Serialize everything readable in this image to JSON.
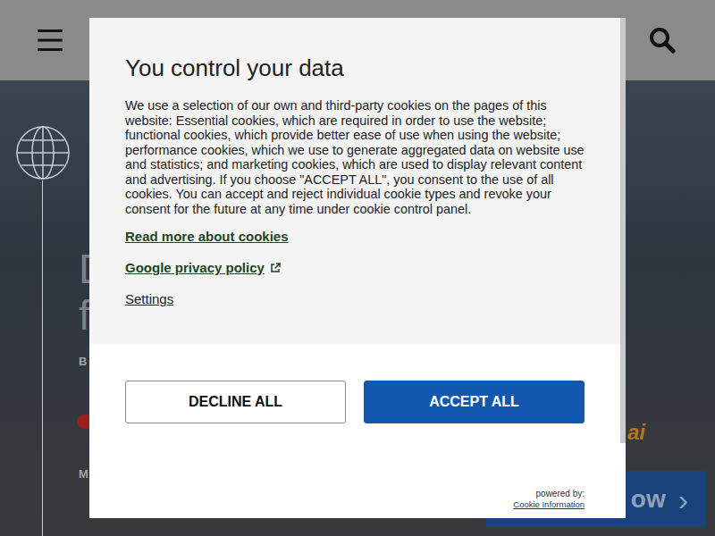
{
  "hero": {
    "fragments": [
      {
        "text": "D",
        "kind": "heading"
      },
      {
        "text": "f",
        "kind": "heading"
      },
      {
        "text": "B",
        "kind": "small"
      },
      {
        "text": "M",
        "kind": "label"
      }
    ],
    "accent": "ai",
    "cta": {
      "label": "ow",
      "icon": "›"
    }
  },
  "dialog": {
    "title": "You control your data",
    "body": "We use a selection of our own and third-party cookies on the pages of this website: Essential cookies, which are required in order to use the website; functional cookies, which provide better ease of use when using the website; performance cookies, which we use to generate aggregated data on website use and statistics; and marketing cookies, which are used to display relevant content and advertising. If you choose \"ACCEPT ALL\", you consent to the use of all cookies. You can accept and reject individual cookie types and revoke your consent for the future at any time under cookie control panel.",
    "links": [
      {
        "label": "Read more about cookies",
        "external": false
      },
      {
        "label": "Google privacy policy",
        "external": true
      }
    ],
    "settings": "Settings",
    "buttons": [
      {
        "label": "DECLINE ALL",
        "kind": "secondary"
      },
      {
        "label": "ACCEPT ALL",
        "kind": "primary"
      }
    ],
    "powered_by": "powered by:",
    "provider": "Cookie Information"
  }
}
